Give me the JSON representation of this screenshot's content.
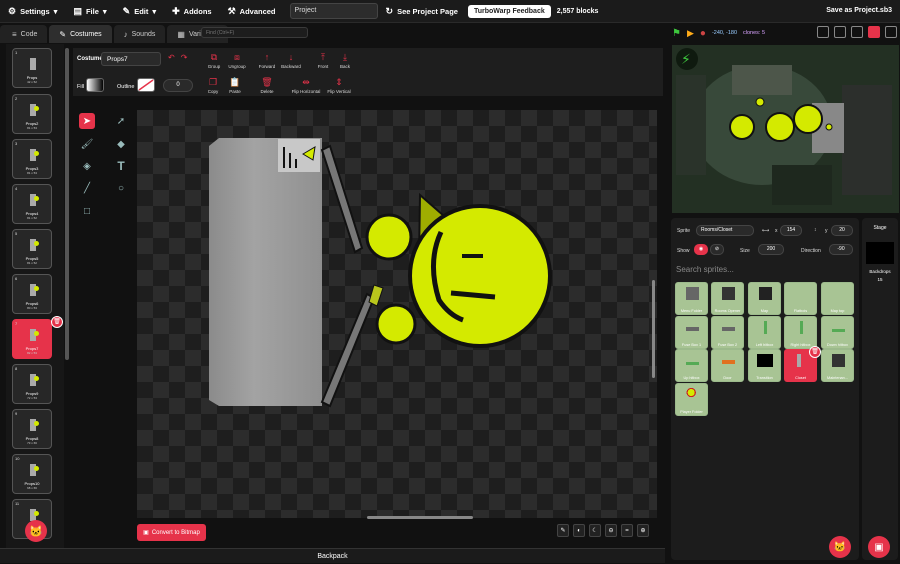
{
  "menubar": {
    "settings": "Settings",
    "file": "File",
    "edit": "Edit",
    "addons": "Addons",
    "advanced": "Advanced",
    "project_title": "Project",
    "see_project_page": "See Project Page",
    "feedback": "TurboWarp Feedback",
    "blocks": "2,557 blocks",
    "save_as": "Save as Project.sb3"
  },
  "tabs": {
    "code": "Code",
    "costumes": "Costumes",
    "sounds": "Sounds",
    "variables": "Variables"
  },
  "find": {
    "placeholder": "Find (Ctrl+F)"
  },
  "stage_controls": {
    "coords": "-240, -180",
    "clones": "clones: 5"
  },
  "costumes": [
    {
      "num": "1",
      "name": "Props",
      "size": "42 x 52"
    },
    {
      "num": "2",
      "name": "Props2",
      "size": "81 x 53"
    },
    {
      "num": "3",
      "name": "Props3",
      "size": "81 x 53"
    },
    {
      "num": "4",
      "name": "Props4",
      "size": "81 x 52"
    },
    {
      "num": "5",
      "name": "Props5",
      "size": "81 x 52"
    },
    {
      "num": "6",
      "name": "Props6",
      "size": "80 x 53"
    },
    {
      "num": "7",
      "name": "Props7",
      "size": "82 x 53"
    },
    {
      "num": "8",
      "name": "Props9",
      "size": "72 x 53"
    },
    {
      "num": "9",
      "name": "Props8",
      "size": "73 x 66"
    },
    {
      "num": "10",
      "name": "Props10",
      "size": "68 x 66"
    },
    {
      "num": "11",
      "name": "",
      "size": ""
    }
  ],
  "editor": {
    "costume_label": "Costume",
    "costume_name": "Props7",
    "group": "Group",
    "ungroup": "Ungroup",
    "forward": "Forward",
    "backward": "Backward",
    "front": "Front",
    "back": "Back",
    "copy": "Copy",
    "paste": "Paste",
    "delete": "Delete",
    "flip_h": "Flip Horizontal",
    "flip_v": "Flip Vertical",
    "fill": "Fill",
    "outline": "Outline",
    "outline_width": "0",
    "convert": "Convert to Bitmap",
    "zoom_reset": "="
  },
  "sprite_info": {
    "sprite_label": "Sprite",
    "sprite_name": "Rooms/Closet",
    "x_label": "x",
    "x": "154",
    "y_label": "y",
    "y": "20",
    "show_label": "Show",
    "size_label": "Size",
    "size": "200",
    "direction_label": "Direction",
    "direction": "-90"
  },
  "search": {
    "placeholder": "Search sprites..."
  },
  "sprites": [
    {
      "name": "Menu Folder"
    },
    {
      "name": "Rooms Opener"
    },
    {
      "name": "Map"
    },
    {
      "name": "Flatbois"
    },
    {
      "name": "Map top"
    },
    {
      "name": "Fuse Box 1"
    },
    {
      "name": "Fuse Box 2"
    },
    {
      "name": "Left hitbox"
    },
    {
      "name": "Right hitbox"
    },
    {
      "name": "Down hitbox"
    },
    {
      "name": "Up hitbox"
    },
    {
      "name": "Door"
    },
    {
      "name": "Transition"
    },
    {
      "name": "Closet"
    },
    {
      "name": "Maintenan..."
    },
    {
      "name": "Player Folder"
    }
  ],
  "stage_panel": {
    "title": "Stage",
    "backdrops_label": "Backdrops",
    "backdrops_count": "15"
  },
  "backpack": "Backpack",
  "colors": {
    "accent": "#e6334a",
    "sprite_tile": "#a8c494",
    "character": "#d4ea00"
  }
}
